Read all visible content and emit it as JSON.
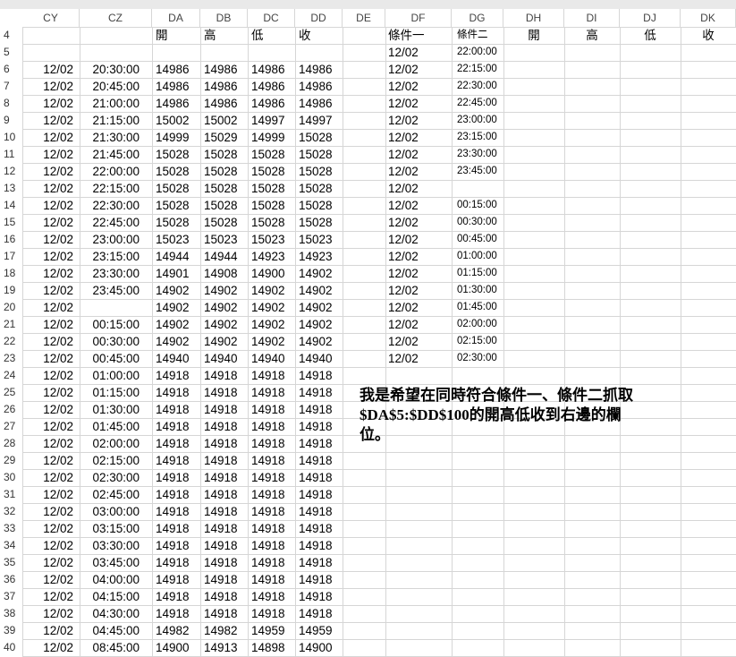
{
  "sheet": {
    "columns": [
      "CY",
      "CZ",
      "DA",
      "DB",
      "DC",
      "DD",
      "DE",
      "DF",
      "DG",
      "DH",
      "DI",
      "DJ",
      "DK"
    ],
    "header_row": {
      "row_number": "4",
      "cells": [
        "",
        "",
        "開",
        "高",
        "低",
        "收",
        "",
        "條件一",
        "條件二",
        "開",
        "高",
        "低",
        "收"
      ]
    },
    "rows": [
      {
        "n": "5",
        "cells": [
          "",
          "",
          "",
          "",
          "",
          "",
          "",
          "12/02",
          "22:00:00",
          "",
          "",
          "",
          ""
        ]
      },
      {
        "n": "6",
        "cells": [
          "12/02",
          "20:30:00",
          "14986",
          "14986",
          "14986",
          "14986",
          "",
          "12/02",
          "22:15:00",
          "",
          "",
          "",
          ""
        ]
      },
      {
        "n": "7",
        "cells": [
          "12/02",
          "20:45:00",
          "14986",
          "14986",
          "14986",
          "14986",
          "",
          "12/02",
          "22:30:00",
          "",
          "",
          "",
          ""
        ]
      },
      {
        "n": "8",
        "cells": [
          "12/02",
          "21:00:00",
          "14986",
          "14986",
          "14986",
          "14986",
          "",
          "12/02",
          "22:45:00",
          "",
          "",
          "",
          ""
        ]
      },
      {
        "n": "9",
        "cells": [
          "12/02",
          "21:15:00",
          "15002",
          "15002",
          "14997",
          "14997",
          "",
          "12/02",
          "23:00:00",
          "",
          "",
          "",
          ""
        ]
      },
      {
        "n": "10",
        "cells": [
          "12/02",
          "21:30:00",
          "14999",
          "15029",
          "14999",
          "15028",
          "",
          "12/02",
          "23:15:00",
          "",
          "",
          "",
          ""
        ]
      },
      {
        "n": "11",
        "cells": [
          "12/02",
          "21:45:00",
          "15028",
          "15028",
          "15028",
          "15028",
          "",
          "12/02",
          "23:30:00",
          "",
          "",
          "",
          ""
        ]
      },
      {
        "n": "12",
        "cells": [
          "12/02",
          "22:00:00",
          "15028",
          "15028",
          "15028",
          "15028",
          "",
          "12/02",
          "23:45:00",
          "",
          "",
          "",
          ""
        ]
      },
      {
        "n": "13",
        "cells": [
          "12/02",
          "22:15:00",
          "15028",
          "15028",
          "15028",
          "15028",
          "",
          "12/02",
          "",
          "",
          "",
          "",
          ""
        ]
      },
      {
        "n": "14",
        "cells": [
          "12/02",
          "22:30:00",
          "15028",
          "15028",
          "15028",
          "15028",
          "",
          "12/02",
          "00:15:00",
          "",
          "",
          "",
          ""
        ]
      },
      {
        "n": "15",
        "cells": [
          "12/02",
          "22:45:00",
          "15028",
          "15028",
          "15028",
          "15028",
          "",
          "12/02",
          "00:30:00",
          "",
          "",
          "",
          ""
        ]
      },
      {
        "n": "16",
        "cells": [
          "12/02",
          "23:00:00",
          "15023",
          "15023",
          "15023",
          "15023",
          "",
          "12/02",
          "00:45:00",
          "",
          "",
          "",
          ""
        ]
      },
      {
        "n": "17",
        "cells": [
          "12/02",
          "23:15:00",
          "14944",
          "14944",
          "14923",
          "14923",
          "",
          "12/02",
          "01:00:00",
          "",
          "",
          "",
          ""
        ]
      },
      {
        "n": "18",
        "cells": [
          "12/02",
          "23:30:00",
          "14901",
          "14908",
          "14900",
          "14902",
          "",
          "12/02",
          "01:15:00",
          "",
          "",
          "",
          ""
        ]
      },
      {
        "n": "19",
        "cells": [
          "12/02",
          "23:45:00",
          "14902",
          "14902",
          "14902",
          "14902",
          "",
          "12/02",
          "01:30:00",
          "",
          "",
          "",
          ""
        ]
      },
      {
        "n": "20",
        "cells": [
          "12/02",
          "",
          "14902",
          "14902",
          "14902",
          "14902",
          "",
          "12/02",
          "01:45:00",
          "",
          "",
          "",
          ""
        ]
      },
      {
        "n": "21",
        "cells": [
          "12/02",
          "00:15:00",
          "14902",
          "14902",
          "14902",
          "14902",
          "",
          "12/02",
          "02:00:00",
          "",
          "",
          "",
          ""
        ]
      },
      {
        "n": "22",
        "cells": [
          "12/02",
          "00:30:00",
          "14902",
          "14902",
          "14902",
          "14902",
          "",
          "12/02",
          "02:15:00",
          "",
          "",
          "",
          ""
        ]
      },
      {
        "n": "23",
        "cells": [
          "12/02",
          "00:45:00",
          "14940",
          "14940",
          "14940",
          "14940",
          "",
          "12/02",
          "02:30:00",
          "",
          "",
          "",
          ""
        ]
      },
      {
        "n": "24",
        "cells": [
          "12/02",
          "01:00:00",
          "14918",
          "14918",
          "14918",
          "14918",
          "",
          "",
          "",
          "",
          "",
          "",
          ""
        ]
      },
      {
        "n": "25",
        "cells": [
          "12/02",
          "01:15:00",
          "14918",
          "14918",
          "14918",
          "14918",
          "",
          "",
          "",
          "",
          "",
          "",
          ""
        ]
      },
      {
        "n": "26",
        "cells": [
          "12/02",
          "01:30:00",
          "14918",
          "14918",
          "14918",
          "14918",
          "",
          "",
          "",
          "",
          "",
          "",
          ""
        ]
      },
      {
        "n": "27",
        "cells": [
          "12/02",
          "01:45:00",
          "14918",
          "14918",
          "14918",
          "14918",
          "",
          "",
          "",
          "",
          "",
          "",
          ""
        ]
      },
      {
        "n": "28",
        "cells": [
          "12/02",
          "02:00:00",
          "14918",
          "14918",
          "14918",
          "14918",
          "",
          "",
          "",
          "",
          "",
          "",
          ""
        ]
      },
      {
        "n": "29",
        "cells": [
          "12/02",
          "02:15:00",
          "14918",
          "14918",
          "14918",
          "14918",
          "",
          "",
          "",
          "",
          "",
          "",
          ""
        ]
      },
      {
        "n": "30",
        "cells": [
          "12/02",
          "02:30:00",
          "14918",
          "14918",
          "14918",
          "14918",
          "",
          "",
          "",
          "",
          "",
          "",
          ""
        ]
      },
      {
        "n": "31",
        "cells": [
          "12/02",
          "02:45:00",
          "14918",
          "14918",
          "14918",
          "14918",
          "",
          "",
          "",
          "",
          "",
          "",
          ""
        ]
      },
      {
        "n": "32",
        "cells": [
          "12/02",
          "03:00:00",
          "14918",
          "14918",
          "14918",
          "14918",
          "",
          "",
          "",
          "",
          "",
          "",
          ""
        ]
      },
      {
        "n": "33",
        "cells": [
          "12/02",
          "03:15:00",
          "14918",
          "14918",
          "14918",
          "14918",
          "",
          "",
          "",
          "",
          "",
          "",
          ""
        ]
      },
      {
        "n": "34",
        "cells": [
          "12/02",
          "03:30:00",
          "14918",
          "14918",
          "14918",
          "14918",
          "",
          "",
          "",
          "",
          "",
          "",
          ""
        ]
      },
      {
        "n": "35",
        "cells": [
          "12/02",
          "03:45:00",
          "14918",
          "14918",
          "14918",
          "14918",
          "",
          "",
          "",
          "",
          "",
          "",
          ""
        ]
      },
      {
        "n": "36",
        "cells": [
          "12/02",
          "04:00:00",
          "14918",
          "14918",
          "14918",
          "14918",
          "",
          "",
          "",
          "",
          "",
          "",
          ""
        ]
      },
      {
        "n": "37",
        "cells": [
          "12/02",
          "04:15:00",
          "14918",
          "14918",
          "14918",
          "14918",
          "",
          "",
          "",
          "",
          "",
          "",
          ""
        ]
      },
      {
        "n": "38",
        "cells": [
          "12/02",
          "04:30:00",
          "14918",
          "14918",
          "14918",
          "14918",
          "",
          "",
          "",
          "",
          "",
          "",
          ""
        ]
      },
      {
        "n": "39",
        "cells": [
          "12/02",
          "04:45:00",
          "14982",
          "14982",
          "14959",
          "14959",
          "",
          "",
          "",
          "",
          "",
          "",
          ""
        ]
      },
      {
        "n": "40",
        "cells": [
          "12/02",
          "08:45:00",
          "14900",
          "14913",
          "14898",
          "14900",
          "",
          "",
          "",
          "",
          "",
          "",
          ""
        ]
      }
    ],
    "note": "我是希望在同時符合條件一、條件二抓取\n$DA$5:$DD$100的開高低收到右邊的欄\n位。"
  }
}
